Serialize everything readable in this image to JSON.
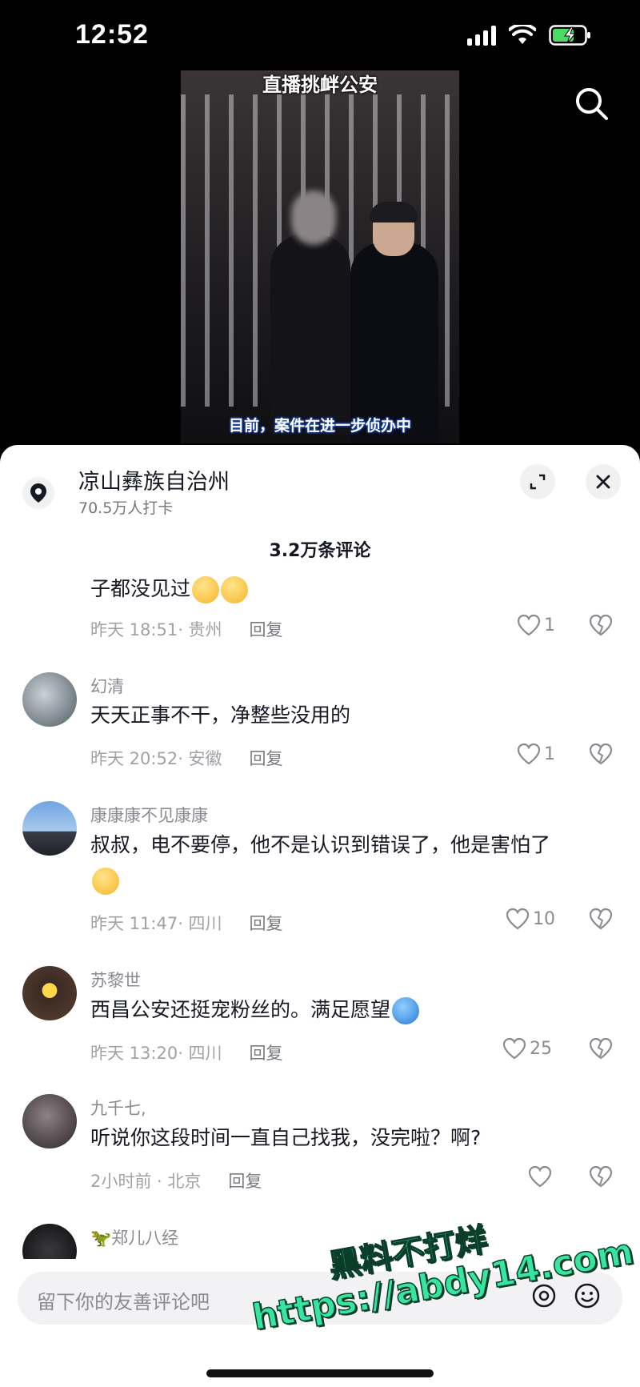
{
  "status_bar": {
    "time": "12:52"
  },
  "video": {
    "caption_top": "直播挑衅公安",
    "caption_bottom": "目前，案件在进一步侦办中"
  },
  "location": {
    "title": "凉山彝族自治州",
    "subtitle": "70.5万人打卡"
  },
  "comments_header": {
    "count": "3.2万条评论"
  },
  "comments": [
    {
      "user": "",
      "text": "子都没见过",
      "time": "昨天 18:51· 贵州",
      "reply": "回复",
      "likes": "1"
    },
    {
      "user": "幻清",
      "text": "天天正事不干，净整些没用的",
      "time": "昨天 20:52· 安徽",
      "reply": "回复",
      "likes": "1"
    },
    {
      "user": "康康康不见康康",
      "text": "叔叔，电不要停，他不是认识到错误了，他是害怕了",
      "time": "昨天 11:47· 四川",
      "reply": "回复",
      "likes": "10"
    },
    {
      "user": "苏黎世",
      "text": "西昌公安还挺宠粉丝的。满足愿望",
      "time": "昨天 13:20· 四川",
      "reply": "回复",
      "likes": "25"
    },
    {
      "user": "九千七,",
      "text": "听说你这段时间一直自己找我，没完啦？啊?",
      "time": "2小时前 · 北京",
      "reply": "回复",
      "likes": ""
    },
    {
      "user": "郑儿八经",
      "text": "",
      "time": "",
      "reply": "",
      "likes": ""
    }
  ],
  "input": {
    "placeholder": "留下你的友善评论吧"
  },
  "watermark": {
    "line1": "黑料不打烊",
    "line2": "https://abdy14.com"
  }
}
